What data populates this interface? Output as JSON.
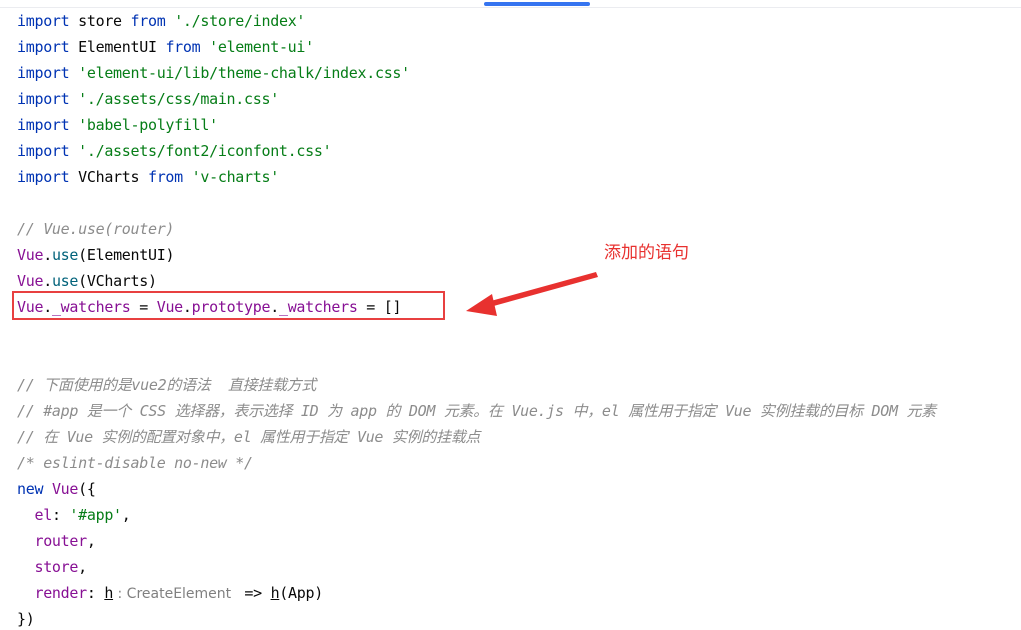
{
  "annotation": {
    "text": "添加的语句",
    "color": "#e8312f"
  },
  "colors": {
    "keyword": "#0033b3",
    "string": "#067d17",
    "vue_global": "#871094",
    "function": "#00627a",
    "comment": "#8c8c8c",
    "highlight_border": "#e84040",
    "scrollbar": "#3574f0"
  },
  "code_lines": [
    [
      {
        "t": "import",
        "c": "kw"
      },
      {
        "t": " store ",
        "c": "id"
      },
      {
        "t": "from",
        "c": "kw"
      },
      {
        "t": " ",
        "c": "id"
      },
      {
        "t": "'./store/index'",
        "c": "str"
      }
    ],
    [
      {
        "t": "import",
        "c": "kw"
      },
      {
        "t": " ElementUI ",
        "c": "id"
      },
      {
        "t": "from",
        "c": "kw"
      },
      {
        "t": " ",
        "c": "id"
      },
      {
        "t": "'element-ui'",
        "c": "str"
      }
    ],
    [
      {
        "t": "import",
        "c": "kw"
      },
      {
        "t": " ",
        "c": "id"
      },
      {
        "t": "'element-ui/lib/theme-chalk/index.css'",
        "c": "str"
      }
    ],
    [
      {
        "t": "import",
        "c": "kw"
      },
      {
        "t": " ",
        "c": "id"
      },
      {
        "t": "'./assets/css/main.css'",
        "c": "str"
      }
    ],
    [
      {
        "t": "import",
        "c": "kw"
      },
      {
        "t": " ",
        "c": "id"
      },
      {
        "t": "'babel-polyfill'",
        "c": "str"
      }
    ],
    [
      {
        "t": "import",
        "c": "kw"
      },
      {
        "t": " ",
        "c": "id"
      },
      {
        "t": "'./assets/font2/iconfont.css'",
        "c": "str"
      }
    ],
    [
      {
        "t": "import",
        "c": "kw"
      },
      {
        "t": " VCharts ",
        "c": "id"
      },
      {
        "t": "from",
        "c": "kw"
      },
      {
        "t": " ",
        "c": "id"
      },
      {
        "t": "'v-charts'",
        "c": "str"
      }
    ],
    [],
    [
      {
        "t": "// Vue.use(router)",
        "c": "cm"
      }
    ],
    [
      {
        "t": "Vue",
        "c": "vue"
      },
      {
        "t": ".",
        "c": "id"
      },
      {
        "t": "use",
        "c": "fn"
      },
      {
        "t": "(ElementUI)",
        "c": "id"
      }
    ],
    [
      {
        "t": "Vue",
        "c": "vue"
      },
      {
        "t": ".",
        "c": "id"
      },
      {
        "t": "use",
        "c": "fn"
      },
      {
        "t": "(VCharts)",
        "c": "id"
      }
    ],
    [
      {
        "t": "Vue",
        "c": "vue"
      },
      {
        "t": ".",
        "c": "id"
      },
      {
        "t": "_watchers",
        "c": "prop"
      },
      {
        "t": " = ",
        "c": "id"
      },
      {
        "t": "Vue",
        "c": "vue"
      },
      {
        "t": ".",
        "c": "id"
      },
      {
        "t": "prototype",
        "c": "prop"
      },
      {
        "t": ".",
        "c": "id"
      },
      {
        "t": "_watchers",
        "c": "prop"
      },
      {
        "t": " = []",
        "c": "id"
      }
    ],
    [],
    [],
    [
      {
        "t": "// 下面使用的是vue2的语法  直接挂载方式",
        "c": "cm"
      }
    ],
    [
      {
        "t": "// #app 是一个 CSS 选择器，表示选择 ID 为 app 的 DOM 元素。在 Vue.js 中，el 属性用于指定 Vue 实例挂载的目标 DOM 元素",
        "c": "cm"
      }
    ],
    [
      {
        "t": "// 在 Vue 实例的配置对象中，el 属性用于指定 Vue 实例的挂载点",
        "c": "cm"
      }
    ],
    [
      {
        "t": "/* eslint-disable no-new */",
        "c": "cm"
      }
    ],
    [
      {
        "t": "new",
        "c": "kw"
      },
      {
        "t": " ",
        "c": "id"
      },
      {
        "t": "Vue",
        "c": "vue"
      },
      {
        "t": "({",
        "c": "id"
      }
    ],
    [
      {
        "t": "  ",
        "c": "id"
      },
      {
        "t": "el",
        "c": "prop"
      },
      {
        "t": ": ",
        "c": "id"
      },
      {
        "t": "'#app'",
        "c": "str"
      },
      {
        "t": ",",
        "c": "id"
      }
    ],
    [
      {
        "t": "  ",
        "c": "id"
      },
      {
        "t": "router",
        "c": "prop"
      },
      {
        "t": ",",
        "c": "id"
      }
    ],
    [
      {
        "t": "  ",
        "c": "id"
      },
      {
        "t": "store",
        "c": "prop"
      },
      {
        "t": ",",
        "c": "id"
      }
    ],
    [
      {
        "t": "  ",
        "c": "id"
      },
      {
        "t": "render",
        "c": "prop"
      },
      {
        "t": ": ",
        "c": "id"
      },
      {
        "t": "h",
        "c": "pm"
      },
      {
        "t": " : CreateElement ",
        "c": "hint"
      },
      {
        "t": " => ",
        "c": "id"
      },
      {
        "t": "h",
        "c": "pm"
      },
      {
        "t": "(App)",
        "c": "id"
      }
    ],
    [
      {
        "t": "})",
        "c": "id"
      }
    ]
  ]
}
